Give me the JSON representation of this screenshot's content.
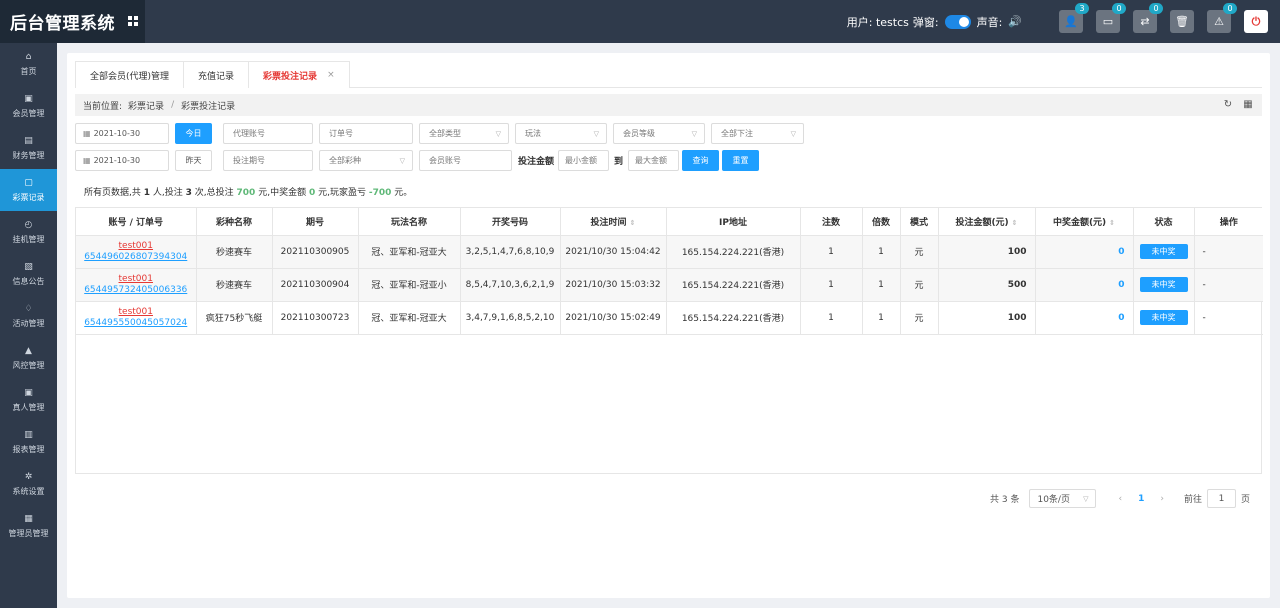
{
  "header": {
    "title": "后台管理系统",
    "user_label": "用户: testcs",
    "popup_label": "弹窗:",
    "sound_label": "声音:",
    "buttons": [
      {
        "icon": "user-icon",
        "glyph": "👤",
        "badge": "3"
      },
      {
        "icon": "card-icon",
        "glyph": "▭",
        "badge": "0"
      },
      {
        "icon": "transfer-icon",
        "glyph": "⇄",
        "badge": "0"
      },
      {
        "icon": "trash-icon",
        "glyph": "🗑",
        "badge": ""
      },
      {
        "icon": "warning-icon",
        "glyph": "⚠",
        "badge": "0"
      },
      {
        "icon": "power-icon",
        "glyph": "⏻",
        "badge": ""
      }
    ]
  },
  "sidebar": {
    "items": [
      {
        "label": "首页",
        "icon": "home-icon",
        "glyph": "⌂"
      },
      {
        "label": "会员管理",
        "icon": "member-icon",
        "glyph": "▣"
      },
      {
        "label": "财务管理",
        "icon": "finance-icon",
        "glyph": "▤"
      },
      {
        "label": "彩票记录",
        "icon": "lottery-icon",
        "glyph": "▢"
      },
      {
        "label": "挂机管理",
        "icon": "clock-icon",
        "glyph": "◴"
      },
      {
        "label": "信息公告",
        "icon": "notice-icon",
        "glyph": "▧"
      },
      {
        "label": "活动管理",
        "icon": "bell-icon",
        "glyph": "♢"
      },
      {
        "label": "风控管理",
        "icon": "risk-icon",
        "glyph": "▲"
      },
      {
        "label": "真人管理",
        "icon": "live-icon",
        "glyph": "▣"
      },
      {
        "label": "报表管理",
        "icon": "report-icon",
        "glyph": "▥"
      },
      {
        "label": "系统设置",
        "icon": "gear-icon",
        "glyph": "✲"
      },
      {
        "label": "管理员管理",
        "icon": "admin-icon",
        "glyph": "▦"
      }
    ],
    "active_index": 3
  },
  "tabs": [
    {
      "label": "全部会员(代理)管理"
    },
    {
      "label": "充值记录"
    },
    {
      "label": "彩票投注记录",
      "close": "×"
    }
  ],
  "breadcrumb": {
    "prefix": "当前位置:",
    "level1": "彩票记录",
    "sep": "/",
    "level2": "彩票投注记录"
  },
  "filters": {
    "date_start": "2021-10-30",
    "today_btn": "今日",
    "agent_ph": "代理账号",
    "order_ph": "订单号",
    "type_sel": "全部类型",
    "play_sel": "玩法",
    "level_sel": "会员等级",
    "under_sel": "全部下注",
    "date_end": "2021-10-30",
    "yesterday_btn": "昨天",
    "period_ph": "投注期号",
    "lottery_sel": "全部彩种",
    "member_ph": "会员账号",
    "amount_label": "投注金额",
    "min_ph": "最小金额",
    "to_label": "到",
    "max_ph": "最大金额",
    "query_btn": "查询",
    "reset_btn": "重置"
  },
  "summary": {
    "t1": "所有页数据,共",
    "people": "1",
    "t2": "人,投注",
    "times": "3",
    "t3": "次,总投注",
    "total_bet": "700",
    "t4": "元,中奖金额",
    "win_amount": "0",
    "t5": "元,玩家盈亏",
    "profit": "-700",
    "t6": "元。"
  },
  "table": {
    "columns": [
      "账号 / 订单号",
      "彩种名称",
      "期号",
      "玩法名称",
      "开奖号码",
      "投注时间",
      "IP地址",
      "注数",
      "倍数",
      "模式",
      "投注金额(元)",
      "中奖金额(元)",
      "状态",
      "操作"
    ],
    "rows": [
      {
        "account": "test001",
        "order": "654496026807394304",
        "lottery": "秒速赛车",
        "period": "202110300905",
        "play": "冠、亚军和-冠亚大",
        "numbers": "3,2,5,1,4,7,6,8,10,9",
        "time": "2021/10/30 15:04:42",
        "ip": "165.154.224.221(香港)",
        "count": "1",
        "multiple": "1",
        "mode": "元",
        "bet": "100",
        "win": "0",
        "status": "未中奖",
        "op": "-"
      },
      {
        "account": "test001",
        "order": "654495732405006336",
        "lottery": "秒速赛车",
        "period": "202110300904",
        "play": "冠、亚军和-冠亚小",
        "numbers": "8,5,4,7,10,3,6,2,1,9",
        "time": "2021/10/30 15:03:32",
        "ip": "165.154.224.221(香港)",
        "count": "1",
        "multiple": "1",
        "mode": "元",
        "bet": "500",
        "win": "0",
        "status": "未中奖",
        "op": "-"
      },
      {
        "account": "test001",
        "order": "654495550045057024",
        "lottery": "疯狂75秒飞艇",
        "period": "202110300723",
        "play": "冠、亚军和-冠亚大",
        "numbers": "3,4,7,9,1,6,8,5,2,10",
        "time": "2021/10/30 15:02:49",
        "ip": "165.154.224.221(香港)",
        "count": "1",
        "multiple": "1",
        "mode": "元",
        "bet": "100",
        "win": "0",
        "status": "未中奖",
        "op": "-"
      }
    ]
  },
  "pager": {
    "total": "共 3 条",
    "per_page": "10条/页",
    "prev": "‹",
    "current": "1",
    "next": "›",
    "goto_label": "前往",
    "goto_value": "1",
    "page_unit": "页"
  },
  "colors": {
    "topbar": "#2f3a4b",
    "brand_bg": "#1e2936",
    "active_nav": "#1f96d8",
    "primary": "#1e9fff",
    "danger": "#e53935",
    "success": "#5fb878"
  }
}
